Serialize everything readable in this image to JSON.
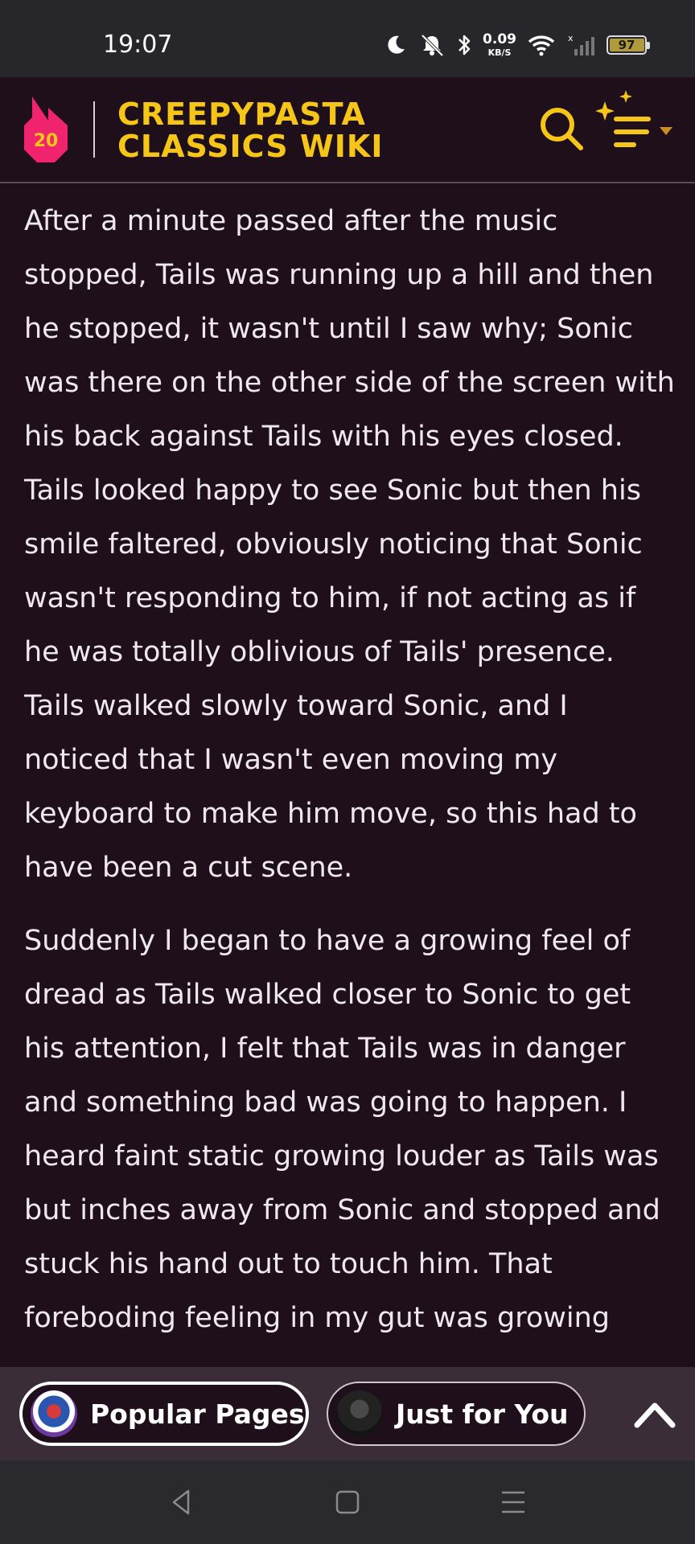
{
  "status_bar": {
    "time": "19:07",
    "net_speed_value": "0.09",
    "net_speed_unit": "KB/S",
    "battery_level": "97",
    "icons": [
      "moon-icon",
      "mute-bell-icon",
      "bluetooth-icon",
      "wifi-icon",
      "cell-signal-icon",
      "battery-icon"
    ]
  },
  "header": {
    "logo_badge": "20",
    "title_line1": "CREEPYPASTA",
    "title_line2": "CLASSICS WIKI",
    "accent_color": "#f5c518",
    "icons": [
      "fandom-flame-icon",
      "search-icon",
      "sparkle-menu-icon",
      "caret-down-icon"
    ]
  },
  "article": {
    "paragraphs": [
      "After a minute passed after the music stopped, Tails was running up a hill and then he stopped, it wasn't until I saw why; Sonic was there on the other side of the screen with his back against Tails with his eyes closed. Tails looked happy to see Sonic but then his smile faltered, obviously noticing that Sonic wasn't responding to him, if not acting as if he was totally oblivious of Tails' presence. Tails walked slowly toward Sonic, and I noticed that I wasn't even moving my keyboard to make him move, so this had to have been a cut scene.",
      "Suddenly I began to have a growing feel of dread as Tails walked closer to Sonic to get his attention, I felt that Tails was in danger and something bad was going to happen. I heard faint static growing louder as Tails was but inches away from Sonic and stopped and stuck his hand out to touch him. That foreboding feeling in my gut was growing"
    ]
  },
  "bottom_bar": {
    "popular_label": "Popular Pages",
    "foryou_label": "Just for You",
    "icons": [
      "chevron-up-icon"
    ]
  },
  "nav_bar": {
    "icons": [
      "back-icon",
      "home-icon",
      "recents-icon"
    ]
  }
}
